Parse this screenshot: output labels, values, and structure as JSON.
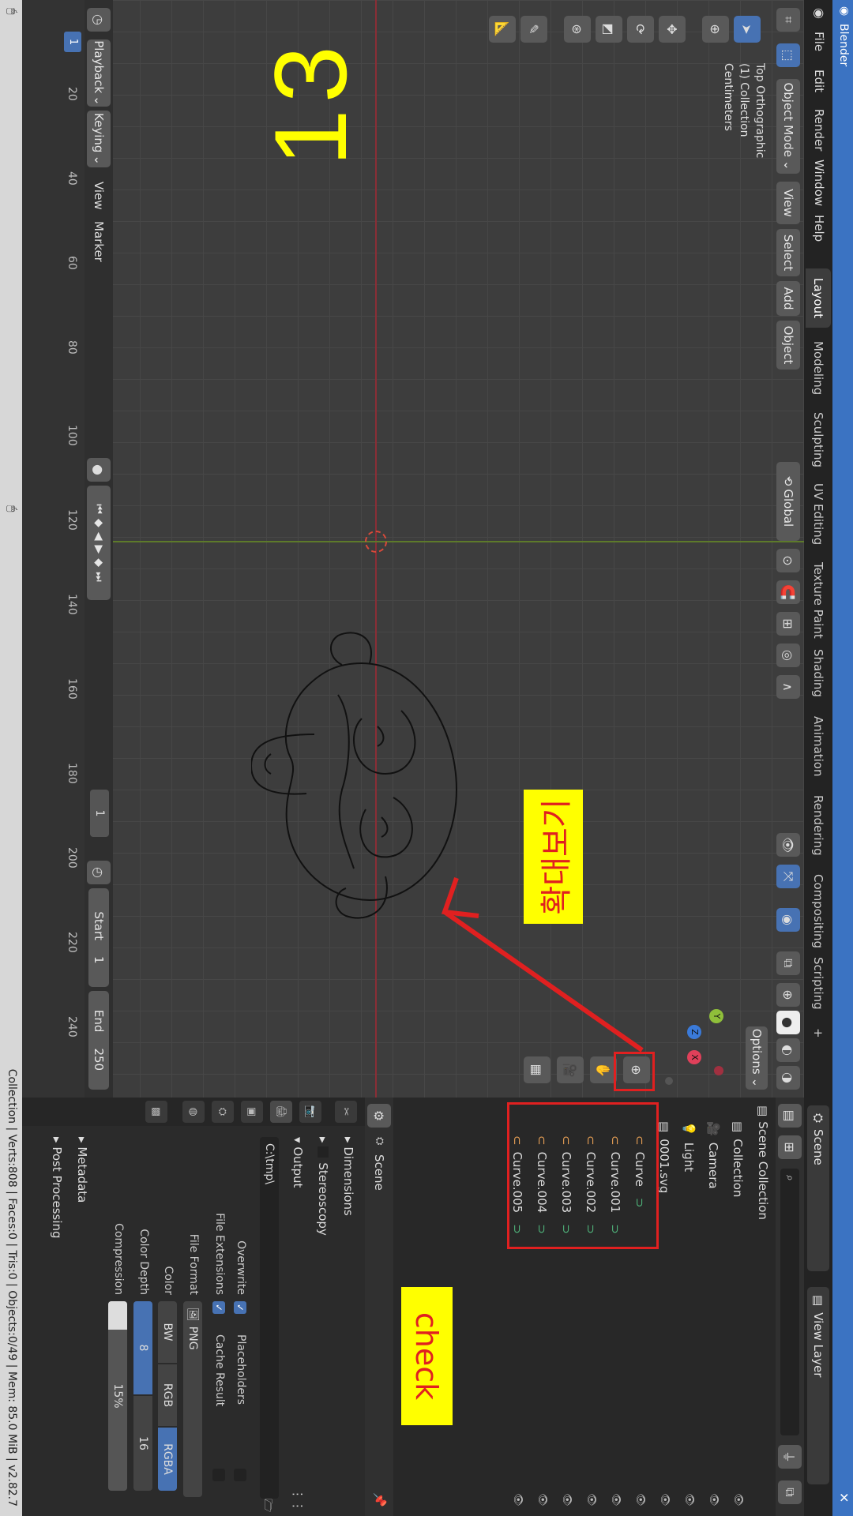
{
  "app": {
    "title": "Blender"
  },
  "menu": {
    "items": [
      "File",
      "Edit",
      "Render",
      "Window",
      "Help"
    ]
  },
  "workspaces": [
    "Layout",
    "Modeling",
    "Sculpting",
    "UV Editing",
    "Texture Paint",
    "Shading",
    "Animation",
    "Rendering",
    "Compositing",
    "Scripting"
  ],
  "workspace_add": "+",
  "scene_selector": {
    "label": "Scene",
    "view_layer": "View Layer"
  },
  "viewport": {
    "mode": "Object Mode",
    "menus": [
      "View",
      "Select",
      "Add",
      "Object"
    ],
    "transform_orientation": "Global",
    "options_label": "Options",
    "info_lines": [
      "Top Orthographic",
      "(1) Collection",
      "Centimeters"
    ],
    "gizmo_axes": {
      "y": "Y",
      "z": "Z",
      "x": "X"
    }
  },
  "annotations": {
    "step_number": "13",
    "zoom_label": "확대보기",
    "check_label": "check",
    "accent_red": "#e02020",
    "label_yellow": "#ffff00"
  },
  "timeline": {
    "menus": [
      "Playback",
      "Keying",
      "View",
      "Marker"
    ],
    "current_frame": "1",
    "frame_display": "1",
    "start_label": "Start",
    "start_value": "1",
    "end_label": "End",
    "end_value": "250",
    "ticks": [
      "20",
      "40",
      "60",
      "80",
      "100",
      "120",
      "140",
      "160",
      "180",
      "200",
      "220",
      "240"
    ]
  },
  "outliner": {
    "root": "Scene Collection",
    "items": [
      {
        "name": "Collection",
        "kind": "collection"
      },
      {
        "name": "Camera",
        "kind": "camera"
      },
      {
        "name": "Light",
        "kind": "light"
      },
      {
        "name": "0001.svg",
        "kind": "collection"
      },
      {
        "name": "Curve",
        "kind": "curve"
      },
      {
        "name": "Curve.001",
        "kind": "curve"
      },
      {
        "name": "Curve.002",
        "kind": "curve"
      },
      {
        "name": "Curve.003",
        "kind": "curve"
      },
      {
        "name": "Curve.004",
        "kind": "curve"
      },
      {
        "name": "Curve.005",
        "kind": "curve"
      }
    ]
  },
  "properties": {
    "context": "Scene",
    "panels": [
      "Dimensions",
      "Stereoscopy",
      "Output",
      "Metadata",
      "Post Processing"
    ],
    "output_path": "C:\\tmp\\",
    "overwrite_label": "Overwrite",
    "placeholders_label": "Placeholders",
    "file_extensions_label": "File Extensions",
    "cache_result_label": "Cache Result",
    "file_format_label": "File Format",
    "file_format_value": "PNG",
    "color_label": "Color",
    "color_options": [
      "BW",
      "RGB",
      "RGBA"
    ],
    "color_selected": "RGBA",
    "color_depth_label": "Color Depth",
    "color_depth_options": [
      "8",
      "16"
    ],
    "color_depth_selected": "8",
    "compression_label": "Compression",
    "compression_value": "15%",
    "compression_fraction": 0.15
  },
  "statusbar": {
    "text": "Collection | Verts:808 | Faces:0 | Tris:0 | Objects:0/49 | Mem: 85.0 MiB | v2.82.7"
  }
}
